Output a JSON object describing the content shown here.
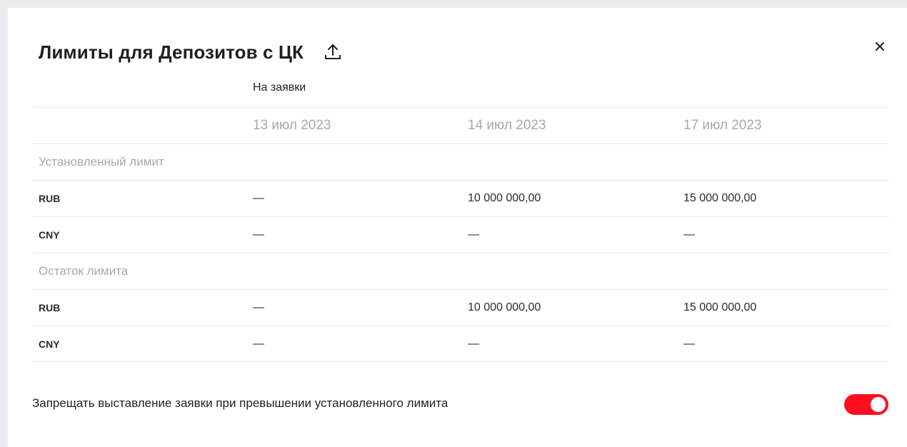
{
  "dialog": {
    "title": "Лимиты для Депозитов с ЦК",
    "export_icon": "upload-icon",
    "close_icon": "close-icon",
    "section_label": "На заявки"
  },
  "table": {
    "dates": [
      "13 июл 2023",
      "14 июл 2023",
      "17 июл 2023"
    ],
    "groups": [
      {
        "title": "Установленный лимит",
        "rows": [
          {
            "currency": "RUB",
            "values": [
              "—",
              "10 000 000,00",
              "15 000 000,00"
            ]
          },
          {
            "currency": "CNY",
            "values": [
              "—",
              "—",
              "—"
            ]
          }
        ]
      },
      {
        "title": "Остаток лимита",
        "rows": [
          {
            "currency": "RUB",
            "values": [
              "—",
              "10 000 000,00",
              "15 000 000,00"
            ]
          },
          {
            "currency": "CNY",
            "values": [
              "—",
              "—",
              "—"
            ]
          }
        ]
      }
    ]
  },
  "footer": {
    "toggle_label": "Запрещать выставление заявки при превышении установленного лимита",
    "toggle_on": true,
    "accent_color": "#ff0f1e"
  }
}
